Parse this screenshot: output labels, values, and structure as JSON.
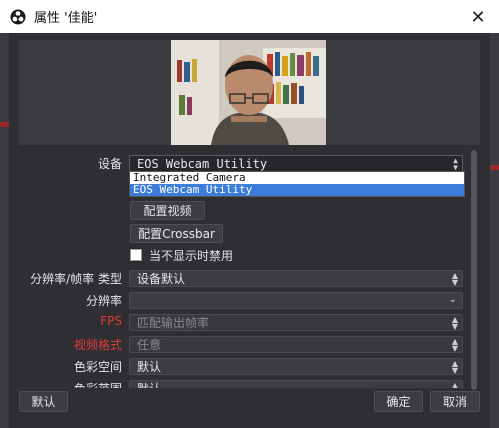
{
  "window": {
    "title": "属性 '佳能'",
    "close_glyph": "✕"
  },
  "form": {
    "device": {
      "label": "设备",
      "value": "EOS Webcam Utility",
      "options": [
        "Integrated Camera",
        "EOS Webcam Utility"
      ],
      "selected_index": 1
    },
    "configure_video_label": "配置视频",
    "configure_crossbar_label": "配置Crossbar",
    "deactivate_when_hidden": {
      "label": "当不显示时禁用",
      "checked": false
    },
    "resolution_fps_type": {
      "label": "分辨率/帧率 类型",
      "value": "设备默认"
    },
    "resolution": {
      "label": "分辨率",
      "value": ""
    },
    "fps": {
      "label": "FPS",
      "value": "匹配输出帧率"
    },
    "video_format": {
      "label": "视频格式",
      "value": "任意"
    },
    "color_space": {
      "label": "色彩空间",
      "value": "默认"
    },
    "color_range": {
      "label": "色彩范围",
      "value": "默认"
    }
  },
  "footer": {
    "defaults_label": "默认",
    "ok_label": "确定",
    "cancel_label": "取消"
  },
  "colors": {
    "accent_selection": "#3b7dd8",
    "disabled_label": "#e03b3b",
    "dialog_bg": "#2e2e33"
  }
}
